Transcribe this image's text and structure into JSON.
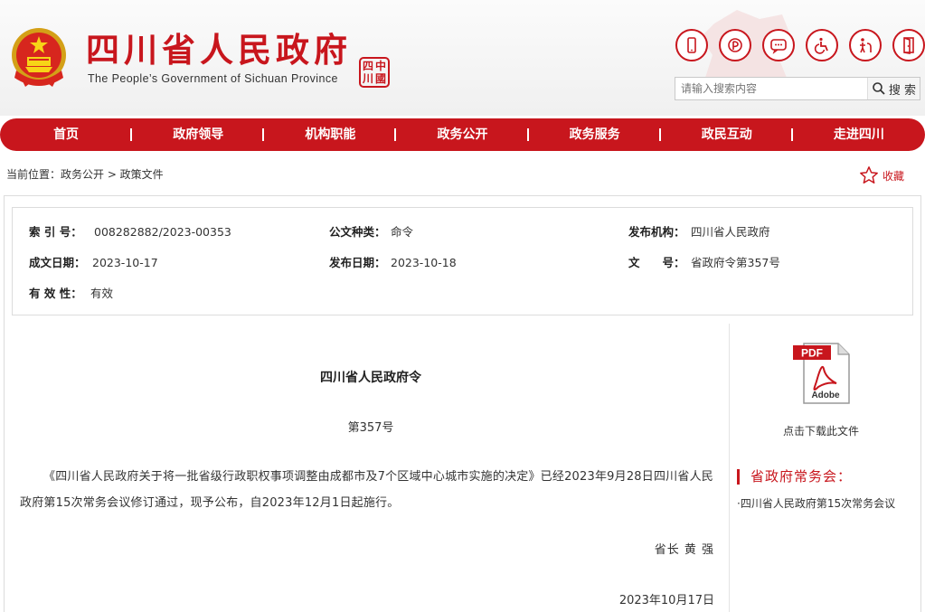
{
  "header": {
    "title": "四川省人民政府",
    "subtitle": "The People’s Government of Sichuan Province",
    "seal_chars": [
      "四",
      "中",
      "川",
      "國"
    ],
    "search": {
      "placeholder": "请输入搜索内容",
      "button_label": "搜 索"
    },
    "top_icons": [
      "mobile-icon",
      "weibo-icon",
      "wechat-icon",
      "accessibility-icon",
      "elder-care-icon",
      "exit-icon"
    ]
  },
  "nav": {
    "items": [
      "首页",
      "政府领导",
      "机构职能",
      "政务公开",
      "政务服务",
      "政民互动",
      "走进四川"
    ]
  },
  "breadcrumb": {
    "text": "当前位置：政务公开 > 政策文件"
  },
  "favorite": {
    "label": "收藏"
  },
  "meta": {
    "index_key": "索 引 号：",
    "index_value": "008282882/2023-00353",
    "type_key": "公文种类：",
    "type_value": "命令",
    "issuer_key": "发布机构：",
    "issuer_value": "四川省人民政府",
    "written_key": "成文日期：",
    "written_value": "2023-10-17",
    "published_key": "发布日期：",
    "published_value": "2023-10-18",
    "docno_key": "文　　号：",
    "docno_value": "省政府令第357号",
    "validity_key": "有 效 性：",
    "validity_value": "有效"
  },
  "document": {
    "title": "四川省人民政府令",
    "number": "第357号",
    "body": "《四川省人民政府关于将一批省级行政职权事项调整由成都市及7个区域中心城市实施的决定》已经2023年9月28日四川省人民政府第15次常务会议修订通过，现予公布，自2023年12月1日起施行。",
    "signer": "省长 黄 强",
    "date": "2023年10月17日"
  },
  "sidebar": {
    "pdf_badge": "PDF",
    "pdf_brand": "Adobe",
    "pdf_label": "点击下载此文件",
    "heading": "省政府常务会：",
    "link": "·四川省人民政府第15次常务会议"
  },
  "colors": {
    "brand_red": "#c8161d",
    "border": "#dcdcdc"
  }
}
